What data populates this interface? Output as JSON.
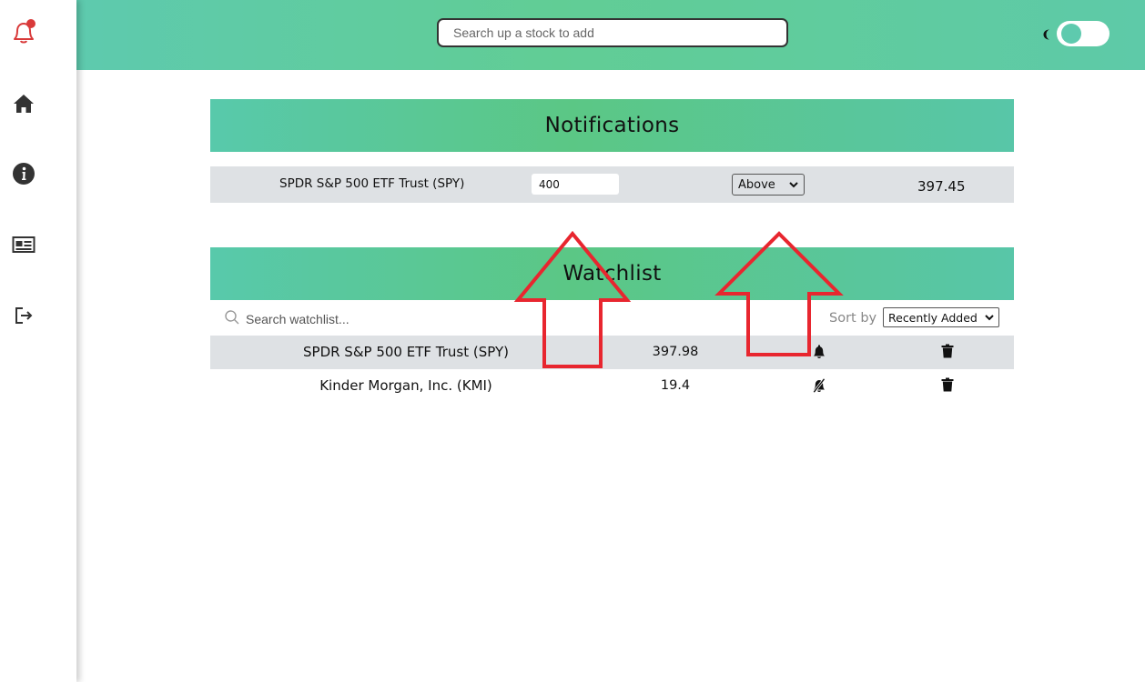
{
  "sidebar": {
    "items": [
      {
        "icon": "bell-alert-icon"
      },
      {
        "icon": "home-icon"
      },
      {
        "icon": "info-icon"
      },
      {
        "icon": "news-icon"
      },
      {
        "icon": "logout-icon"
      }
    ]
  },
  "header": {
    "search_placeholder": "Search up a stock to add",
    "theme_icon": "moon-icon"
  },
  "notifications": {
    "title": "Notifications",
    "rows": [
      {
        "name": "SPDR S&P 500 ETF Trust (SPY)",
        "target_value": "400",
        "condition": "Above",
        "price": "397.45"
      }
    ]
  },
  "watchlist": {
    "title": "Watchlist",
    "search_placeholder": "Search watchlist...",
    "sort_label": "Sort by",
    "sort_value": "Recently Added",
    "rows": [
      {
        "name": "SPDR S&P 500 ETF Trust (SPY)",
        "price": "397.98",
        "alert": "bell-icon"
      },
      {
        "name": "Kinder Morgan, Inc. (KMI)",
        "price": "19.4",
        "alert": "bell-slash-icon"
      }
    ]
  },
  "colors": {
    "accent": "#5ecaae",
    "alert_red": "#d93a3a",
    "annotation_red": "#e8262f",
    "row_gray": "#dee1e4"
  }
}
